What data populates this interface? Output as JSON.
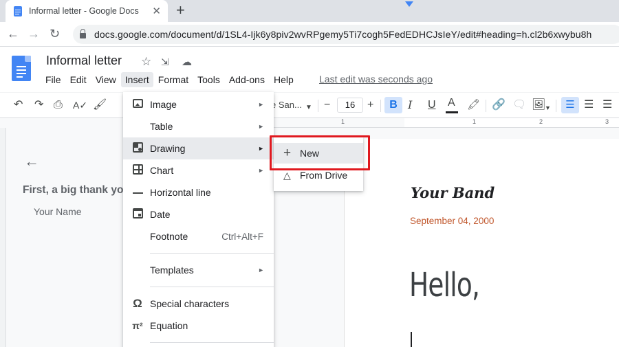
{
  "browser": {
    "tab_title": "Informal letter - Google Docs",
    "tab_close": "✕",
    "new_tab": "+",
    "back": "←",
    "forward": "→",
    "reload": "↻",
    "url": "docs.google.com/document/d/1SL4-Ijk6y8piv2wvRPgemy5Ti7cogh5FedEDHCJsIeY/edit#heading=h.cl2b6xwybu8h"
  },
  "doc": {
    "title": "Informal letter",
    "menu": [
      "File",
      "Edit",
      "View",
      "Insert",
      "Format",
      "Tools",
      "Add-ons",
      "Help"
    ],
    "last_edit": "Last edit was seconds ago"
  },
  "toolbar": {
    "font": "e San...",
    "font_size": "16",
    "minus": "−",
    "plus": "+",
    "bold": "B",
    "italic": "I",
    "underline": "U",
    "text_color": "A"
  },
  "ruler": [
    "1",
    "1",
    "2",
    "3"
  ],
  "outline": {
    "back": "←",
    "heading": "First, a big thank you",
    "subheading": "Your Name"
  },
  "insert_menu": {
    "items": [
      {
        "label": "Image",
        "arrow": "►"
      },
      {
        "label": "Table",
        "arrow": "►"
      },
      {
        "label": "Drawing",
        "arrow": "►"
      },
      {
        "label": "Chart",
        "arrow": "►"
      },
      {
        "label": "Horizontal line"
      },
      {
        "label": "Date"
      },
      {
        "label": "Footnote",
        "shortcut": "Ctrl+Alt+F"
      },
      {
        "label": "Templates",
        "arrow": "►"
      },
      {
        "label": "Special characters",
        "icon": "Ω"
      },
      {
        "label": "Equation",
        "icon": "π²"
      }
    ]
  },
  "drawing_submenu": {
    "items": [
      {
        "label": "New",
        "icon": "+"
      },
      {
        "label": "From Drive",
        "icon": "△"
      }
    ]
  },
  "page": {
    "band": "Your Band",
    "date": "September 04, 2000",
    "greeting": "Hello,"
  },
  "colors": {
    "accent_blue": "#1a73e8",
    "highlight_red": "#e0191f",
    "date_orange": "#c0562b"
  }
}
